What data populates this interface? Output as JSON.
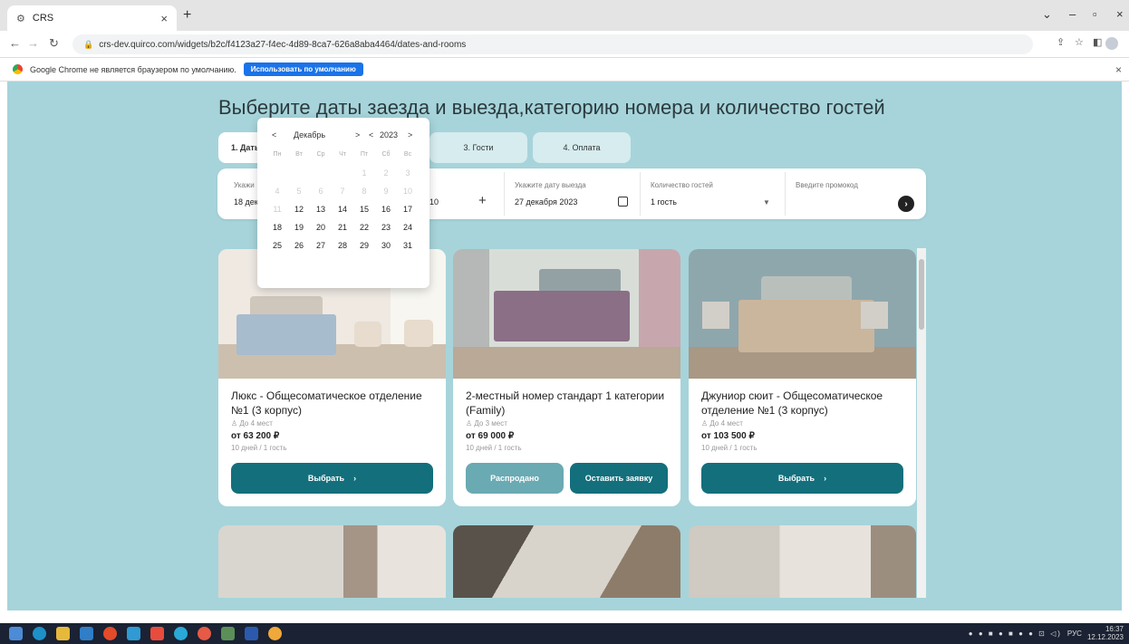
{
  "browser": {
    "tab_title": "CRS",
    "tab_close": "×",
    "new_tab": "+",
    "url": "crs-dev.quirco.com/widgets/b2c/f4123a27-f4ec-4d89-8ca7-626a8aba4464/dates-and-rooms",
    "win_min": "–",
    "win_max": "▫",
    "win_close": "×"
  },
  "infobar": {
    "message": "Google Chrome не является браузером по умолчанию.",
    "button": "Использовать по умолчанию",
    "close": "×"
  },
  "page": {
    "title": "Выберите даты заезда и выезда,категорию номера и количество гостей"
  },
  "steps": [
    {
      "label": "1. Даты"
    },
    {
      "label": "3. Гости"
    },
    {
      "label": "4. Оплата"
    }
  ],
  "form": {
    "checkin_label": "Укажи",
    "checkin_value": "18 дек",
    "nights_value": "10",
    "nights_plus": "+",
    "checkout_label": "Укажите дату выезда",
    "checkout_value": "27 декабря 2023",
    "guests_label": "Количество гостей",
    "guests_value": "1 гость",
    "promo_label": "Введите промокод"
  },
  "calendar": {
    "month": "Декабрь",
    "year": "2023",
    "prev": "<",
    "next": ">",
    "weekdays": [
      "Пн",
      "Вт",
      "Ср",
      "Чт",
      "Пт",
      "Сб",
      "Вс"
    ],
    "weeks": [
      [
        "",
        "",
        "",
        "",
        "1",
        "2",
        "3"
      ],
      [
        "4",
        "5",
        "6",
        "7",
        "8",
        "9",
        "10"
      ],
      [
        "11",
        "12",
        "13",
        "14",
        "15",
        "16",
        "17"
      ],
      [
        "18",
        "19",
        "20",
        "21",
        "22",
        "23",
        "24"
      ],
      [
        "25",
        "26",
        "27",
        "28",
        "29",
        "30",
        "31"
      ]
    ],
    "first_enabled_day": 12
  },
  "rooms": [
    {
      "name": "Люкс - Общесоматическое отделение №1 (3 корпус)",
      "capacity": "До 4 мест",
      "price": "от 63 200 ₽",
      "note": "10 дней / 1 гость",
      "button": "Выбрать",
      "colors": {
        "wall": "#efe9e2",
        "bed": "#a7bccd",
        "floor": "#cdbfae"
      }
    },
    {
      "name": "2-местный номер стандарт 1 категории (Family)",
      "capacity": "До 3 мест",
      "price": "от 69 000 ₽",
      "note": "10 дней / 1 гость",
      "sold_button": "Распродано",
      "request_button": "Оставить заявку",
      "colors": {
        "wall": "#d9ddd8",
        "bed": "#8a6f86",
        "floor": "#b9a996"
      }
    },
    {
      "name": "Джуниор сюит - Общесоматическое отделение №1 (3 корпус)",
      "capacity": "До 4 мест",
      "price": "от 103 500 ₽",
      "note": "10 дней / 1 гость",
      "button": "Выбрать",
      "colors": {
        "wall": "#8ea7ad",
        "bed": "#c9b69d",
        "floor": "#a89884"
      }
    }
  ],
  "taskbar": {
    "lang": "РУС",
    "time": "16:37",
    "date": "12.12.2023"
  },
  "colors": {
    "accent": "#136f7c",
    "page_bg": "#a6d4da",
    "sold": "#6aaab3"
  }
}
